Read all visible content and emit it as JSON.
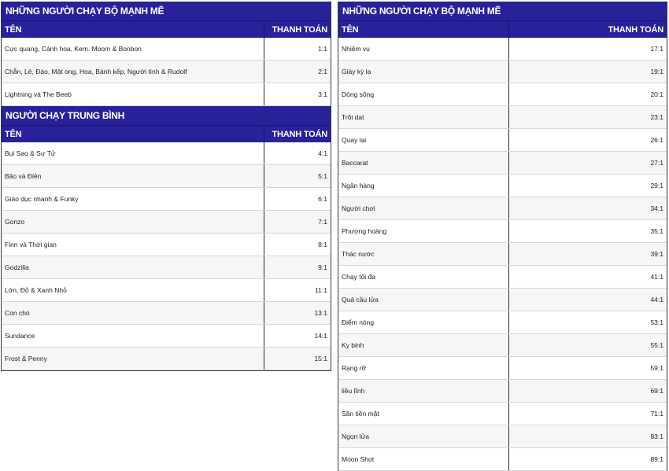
{
  "strong_runners_left": {
    "title": "NHỮNG NGƯỜI CHẠY BỘ MẠNH MẼ",
    "header": {
      "name": "TÊN",
      "pay": "THANH TOÁN"
    },
    "rows": [
      {
        "name": "Cực quang, Cánh hoa, Kem. Moom & Bonbon",
        "pay": "1:1"
      },
      {
        "name": "Chẵn, Lẻ, Đào, Mật ong, Hoa, Bánh kếp, Người tình & Rudolf",
        "pay": "2:1"
      },
      {
        "name": "Lightning và The Beeb",
        "pay": "3:1"
      }
    ]
  },
  "medium_runners": {
    "title": "NGƯỜI CHẠY TRUNG BÌNH",
    "header": {
      "name": "TÊN",
      "pay": "THANH TOÁN"
    },
    "rows": [
      {
        "name": "Bụi Sao & Sư Tử",
        "pay": "4:1"
      },
      {
        "name": "Bão và Điên",
        "pay": "5:1"
      },
      {
        "name": "Giáo dục nhanh & Funky",
        "pay": "6:1"
      },
      {
        "name": "Gonzo",
        "pay": "7:1"
      },
      {
        "name": "Finn và Thời gian",
        "pay": "8:1"
      },
      {
        "name": "Godzilla",
        "pay": "9:1"
      },
      {
        "name": "Lớn, Đỏ & Xanh Nhỏ",
        "pay": "11:1"
      },
      {
        "name": "Con chó",
        "pay": "13:1"
      },
      {
        "name": "Sundance",
        "pay": "14:1"
      },
      {
        "name": "Frost & Penny",
        "pay": "15:1"
      }
    ]
  },
  "strong_runners_right": {
    "title": "NHỮNG NGƯỜI CHẠY BỘ MẠNH MẼ",
    "header": {
      "name": "TÊN",
      "pay": "THANH TOÁN"
    },
    "rows": [
      {
        "name": "Nhiệm vụ",
        "pay": "17:1"
      },
      {
        "name": "Giày kỳ lạ",
        "pay": "19:1"
      },
      {
        "name": "Dòng sông",
        "pay": "20:1"
      },
      {
        "name": "Trôi dạt",
        "pay": "23:1"
      },
      {
        "name": "Quay lại",
        "pay": "26:1"
      },
      {
        "name": "Baccarat",
        "pay": "27:1"
      },
      {
        "name": "Ngân hàng",
        "pay": "29:1"
      },
      {
        "name": "Người chơi",
        "pay": "34:1"
      },
      {
        "name": "Phượng hoàng",
        "pay": "35:1"
      },
      {
        "name": "Thác nước",
        "pay": "39:1"
      },
      {
        "name": "Chạy tối đa",
        "pay": "41:1"
      },
      {
        "name": "Quả cầu lửa",
        "pay": "44:1"
      },
      {
        "name": "Điểm nóng",
        "pay": "53:1"
      },
      {
        "name": "Kỵ binh",
        "pay": "55:1"
      },
      {
        "name": "Rạng rỡ",
        "pay": "59:1"
      },
      {
        "name": "liều lĩnh",
        "pay": "69:1"
      },
      {
        "name": "Săn tiền mặt",
        "pay": "71:1"
      },
      {
        "name": "Ngọn lửa",
        "pay": "83:1"
      },
      {
        "name": "Moon Shot",
        "pay": "89:1"
      }
    ]
  },
  "colors": {
    "header_bg": "#27219a",
    "header_text": "#ffffff",
    "row_alt_bg": "#f6f6f6",
    "border": "#2a2a2a"
  }
}
